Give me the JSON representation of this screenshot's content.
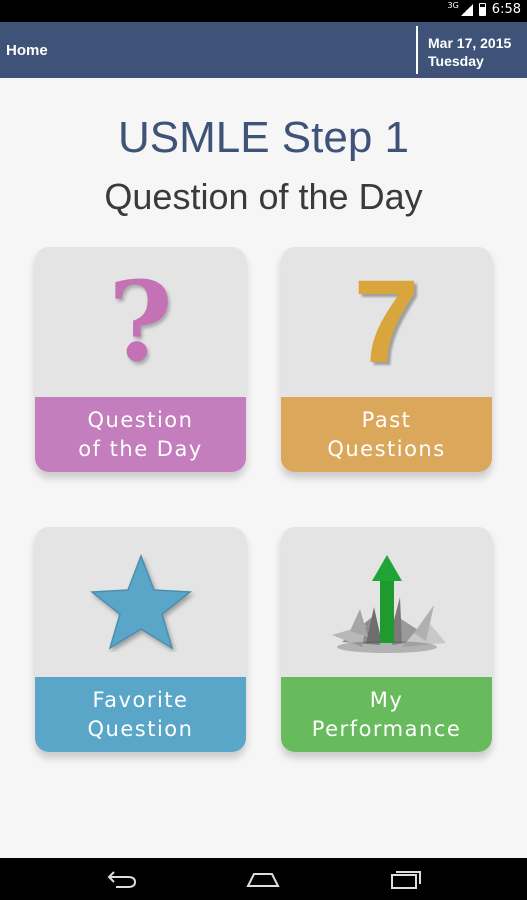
{
  "status_bar": {
    "network": "3G",
    "time": "6:58"
  },
  "app_bar": {
    "home_label": "Home",
    "date": "Mar 17, 2015",
    "weekday": "Tuesday"
  },
  "header": {
    "title": "USMLE Step 1",
    "subtitle": "Question of the Day"
  },
  "tiles": [
    {
      "label_line1": "Question",
      "label_line2": "of the Day",
      "icon": "question-mark-icon",
      "color": "#c47ebd"
    },
    {
      "label_line1": "Past",
      "label_line2": "Questions",
      "icon": "number-seven-icon",
      "color": "#dba75b"
    },
    {
      "label_line1": "Favorite",
      "label_line2": "Question",
      "icon": "star-icon",
      "color": "#5aa6c8"
    },
    {
      "label_line1": "My",
      "label_line2": "Performance",
      "icon": "growth-arrow-icon",
      "color": "#68bb5d"
    }
  ],
  "tile_art": {
    "tile1_glyph": "?",
    "tile2_glyph": "7"
  },
  "nav_bar": {
    "back": "back-icon",
    "home": "home-icon",
    "recents": "recents-icon"
  }
}
